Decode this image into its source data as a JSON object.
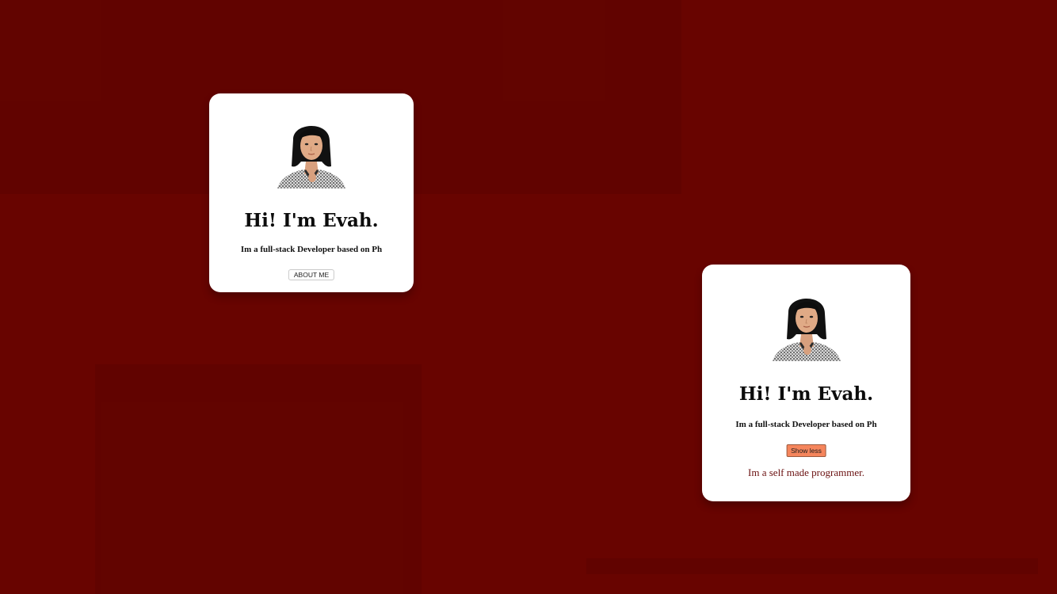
{
  "cards": [
    {
      "state": "collapsed",
      "avatar_icon": "portrait-photo",
      "headline": "Hi! I'm Evah.",
      "subtitle": "Im a full-stack Developer based on Ph",
      "button_label": "ABOUT ME"
    },
    {
      "state": "expanded",
      "avatar_icon": "portrait-photo",
      "headline": "Hi! I'm Evah.",
      "subtitle": "Im a full-stack Developer based on Ph",
      "button_label": "Show less",
      "more_text": "Im a self made programmer."
    }
  ],
  "colors": {
    "background": "#680400",
    "card": "#ffffff",
    "show_less_button": "#f5855c",
    "more_text": "#6a1010"
  }
}
